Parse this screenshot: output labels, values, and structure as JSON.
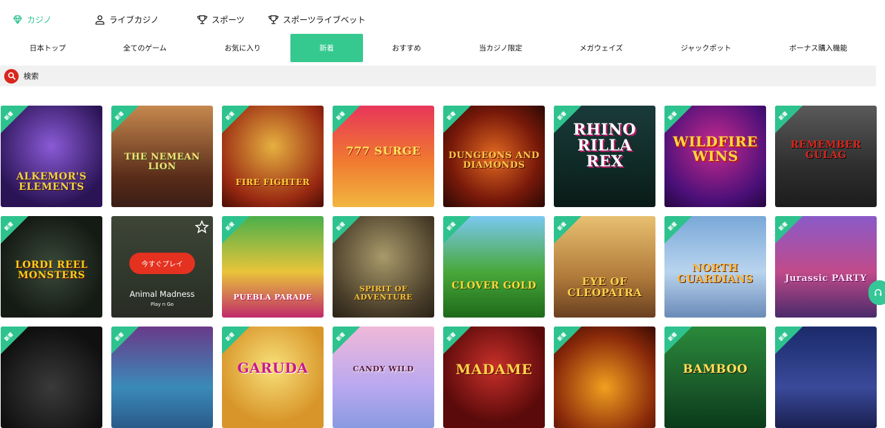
{
  "top_nav": [
    {
      "label": "カジノ",
      "icon": "diamond-icon",
      "active": true
    },
    {
      "label": "ライブカジノ",
      "icon": "dealer-icon",
      "active": false
    },
    {
      "label": "スポーツ",
      "icon": "trophy-icon",
      "active": false
    },
    {
      "label": "スポーツライブベット",
      "icon": "trophy-icon",
      "active": false
    }
  ],
  "categories": [
    {
      "label": "日本トップ"
    },
    {
      "label": "全てのゲーム"
    },
    {
      "label": "お気に入り"
    },
    {
      "label": "新着",
      "active": true
    },
    {
      "label": "おすすめ"
    },
    {
      "label": "当カジノ限定"
    },
    {
      "label": "メガウェイズ"
    },
    {
      "label": "ジャックポット"
    },
    {
      "label": "ボーナス購入機能"
    }
  ],
  "search": {
    "label": "検索"
  },
  "badge_label": "新着",
  "games": [
    {
      "title": "ALKEMOR'S ELEMENTS"
    },
    {
      "title": "THE NEMEAN LION"
    },
    {
      "title": "FIRE FIGHTER"
    },
    {
      "title": "777 SURGE"
    },
    {
      "title": "DUNGEONS AND DIAMONDS"
    },
    {
      "title": "RHINO RILLA REX"
    },
    {
      "title": "WILDFIRE WINS"
    },
    {
      "title": "REMEMBER GULAG"
    },
    {
      "title": "LORDI REEL MONSTERS"
    },
    {
      "title": "Animal Madness",
      "provider": "Play n Go",
      "play_label": "今すぐプレイ"
    },
    {
      "title": "PUEBLA PARADE"
    },
    {
      "title": "SPIRIT OF ADVENTURE"
    },
    {
      "title": "CLOVER GOLD"
    },
    {
      "title": "EYE OF CLEOPATRA"
    },
    {
      "title": "NORTH GUARDIANS"
    },
    {
      "title": "Jurassic PARTY"
    },
    {
      "title": ""
    },
    {
      "title": ""
    },
    {
      "title": "GARUDA"
    },
    {
      "title": "CANDY WILD"
    },
    {
      "title": "MADAME"
    },
    {
      "title": ""
    },
    {
      "title": "BAMBOO"
    },
    {
      "title": ""
    }
  ],
  "colors": {
    "accent": "#35c98f",
    "play_button": "#e5311f",
    "search_icon_bg": "#d8281e"
  }
}
